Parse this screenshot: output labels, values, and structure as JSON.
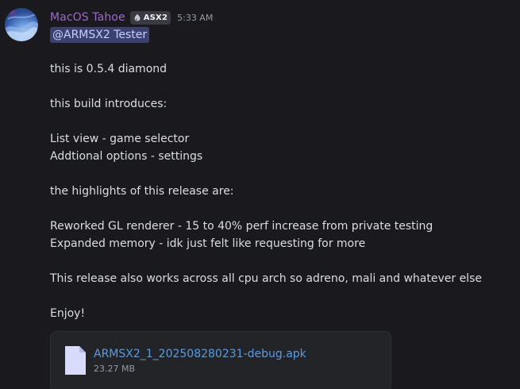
{
  "message": {
    "author": "MacOS Tahoe",
    "tag": "ASX2",
    "timestamp": "5:33 AM",
    "mention": "@ARMSX2 Tester",
    "lines": [
      "this is 0.5.4 diamond",
      "",
      "this build introduces:",
      "",
      "List view - game selector",
      "Addtional options - settings",
      "",
      "the highlights of this release are:",
      "",
      "Reworked GL renderer - 15 to 40% perf increase from private testing",
      "Expanded memory - idk just felt like requesting for more",
      "",
      "This release also works across all cpu arch so adreno, mali and whatever else",
      "",
      "Enjoy!"
    ]
  },
  "attachment": {
    "file_name": "ARMSX2_1_202508280231-debug.apk",
    "file_size": "23.27 MB",
    "icon": "file-icon"
  },
  "colors": {
    "background": "#1a1a1e",
    "username": "#9b6bc8",
    "mention_bg": "#3c4270",
    "link": "#5d9ae0"
  }
}
